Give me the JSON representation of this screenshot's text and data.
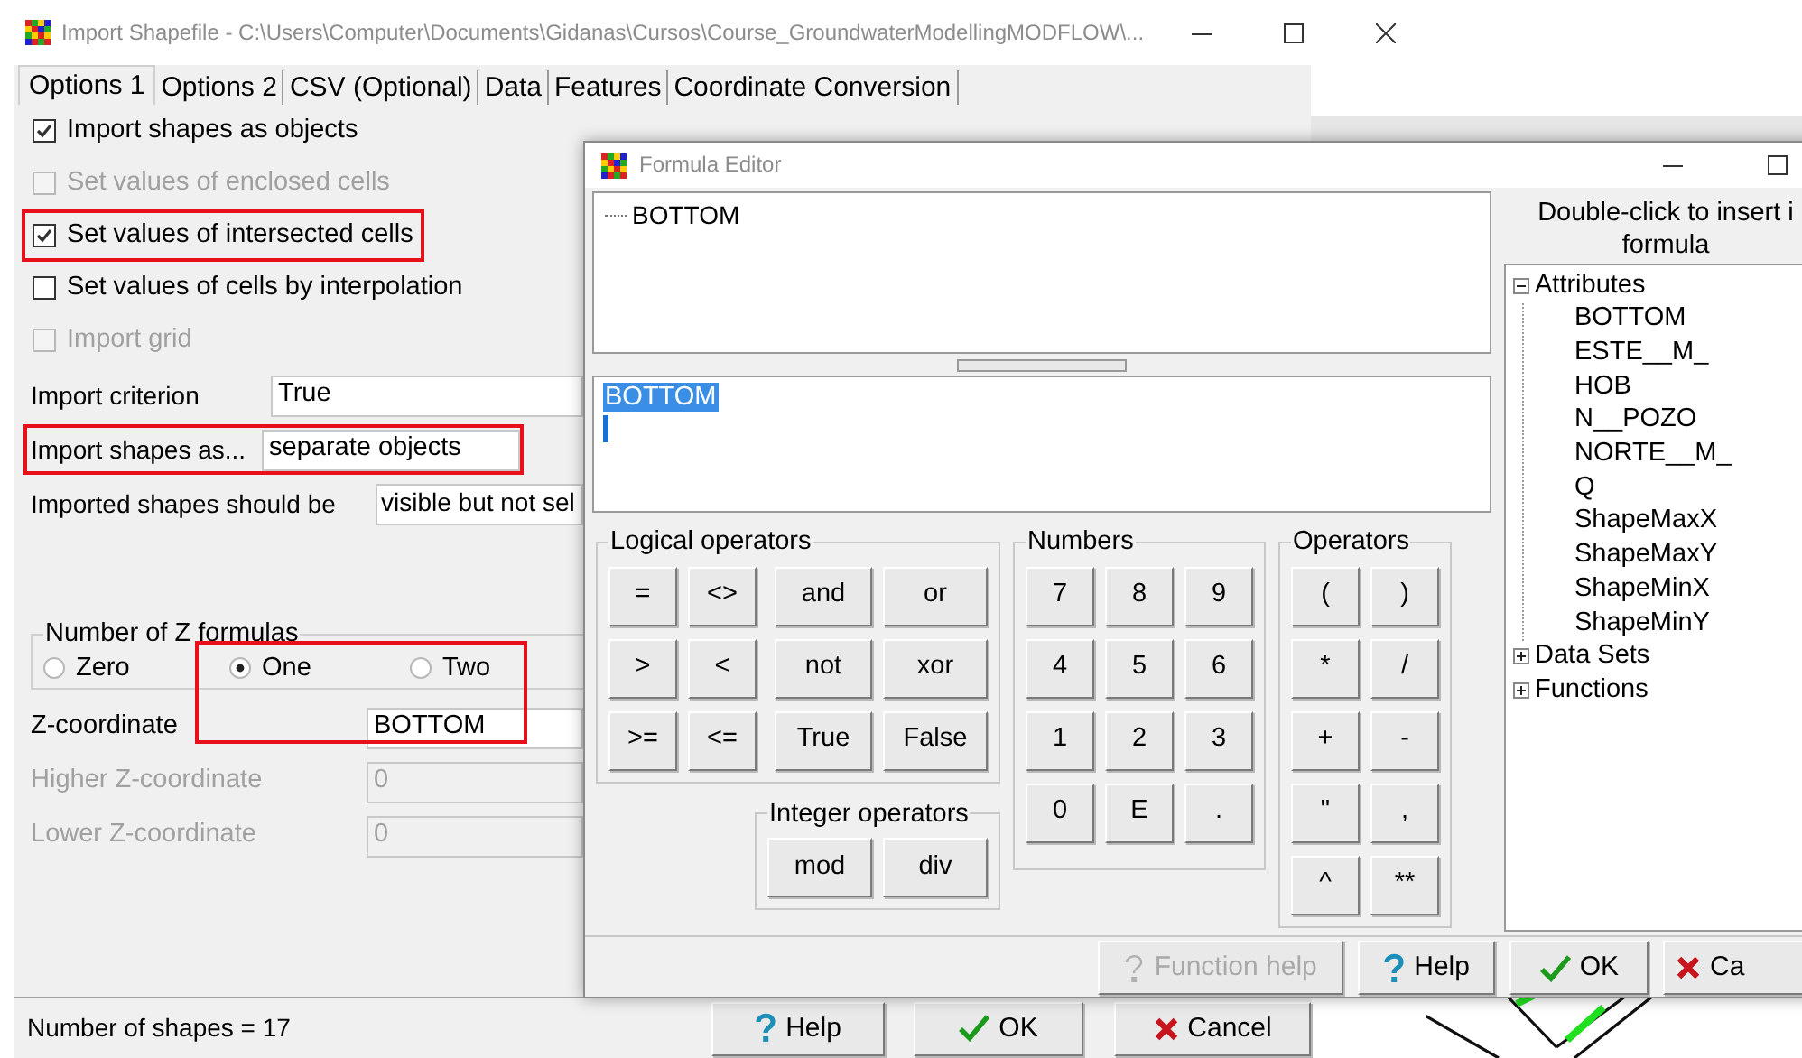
{
  "main_window": {
    "title": "Import Shapefile - C:\\Users\\Computer\\Documents\\Gidanas\\Cursos\\Course_GroundwaterModellingMODFLOW\\...",
    "tabs": [
      {
        "label": "Options 1",
        "selected": true
      },
      {
        "label": "Options 2",
        "selected": false
      },
      {
        "label": "CSV (Optional)",
        "selected": false
      },
      {
        "label": "Data",
        "selected": false
      },
      {
        "label": "Features",
        "selected": false
      },
      {
        "label": "Coordinate Conversion",
        "selected": false
      }
    ],
    "options": [
      {
        "label": "Import shapes as objects",
        "checked": true,
        "disabled": false,
        "highlighted": false
      },
      {
        "label": "Set values of enclosed cells",
        "checked": false,
        "disabled": true,
        "highlighted": false
      },
      {
        "label": "Set values of intersected cells",
        "checked": true,
        "disabled": false,
        "highlighted": true
      },
      {
        "label": "Set values of cells by interpolation",
        "checked": false,
        "disabled": false,
        "highlighted": false
      },
      {
        "label": "Import grid",
        "checked": false,
        "disabled": true,
        "highlighted": false
      }
    ],
    "fields": [
      {
        "label": "Import criterion",
        "value": "True",
        "highlighted": false
      },
      {
        "label": "Import shapes as...",
        "value": "separate objects",
        "highlighted": true
      },
      {
        "label": "Imported shapes should be",
        "value": "visible but not sel",
        "highlighted": false
      }
    ],
    "z_formulas": {
      "title": "Number of Z formulas",
      "highlighted": true,
      "options": [
        {
          "label": "Zero",
          "selected": false
        },
        {
          "label": "One",
          "selected": true
        },
        {
          "label": "Two",
          "selected": false
        }
      ]
    },
    "z_fields": [
      {
        "label": "Z-coordinate",
        "value": "BOTTOM",
        "disabled": false
      },
      {
        "label": "Higher Z-coordinate",
        "value": "0",
        "disabled": true
      },
      {
        "label": "Lower Z-coordinate",
        "value": "0",
        "disabled": true
      }
    ],
    "status": "Number of shapes = 17",
    "buttons": [
      {
        "label": "Help",
        "kind": "help"
      },
      {
        "label": "OK",
        "kind": "ok"
      },
      {
        "label": "Cancel",
        "kind": "cancel"
      }
    ]
  },
  "formula_editor": {
    "title": "Formula Editor",
    "expression_tree": [
      "BOTTOM"
    ],
    "formula": "BOTTOM",
    "groups": [
      {
        "title": "Logical operators",
        "buttons": [
          "=",
          "<>",
          "and",
          "or",
          ">",
          "<",
          "not",
          "xor",
          ">=",
          "<=",
          "True",
          "False"
        ]
      },
      {
        "title": "Integer operators",
        "buttons": [
          "mod",
          "div"
        ]
      },
      {
        "title": "Numbers",
        "buttons": [
          "7",
          "8",
          "9",
          "4",
          "5",
          "6",
          "1",
          "2",
          "3",
          "0",
          "E",
          "."
        ]
      },
      {
        "title": "Operators",
        "buttons": [
          "(",
          ")",
          "*",
          "/",
          "+",
          "-",
          "\"",
          ",",
          "^",
          "**"
        ]
      }
    ],
    "insert_panel": {
      "header_lines": [
        "Double-click to insert i",
        "formula"
      ],
      "tree": [
        {
          "label": "Attributes",
          "expanded": true,
          "children": [
            {
              "label": "BOTTOM"
            },
            {
              "label": "ESTE__M_"
            },
            {
              "label": "HOB"
            },
            {
              "label": "N__POZO"
            },
            {
              "label": "NORTE__M_"
            },
            {
              "label": "Q"
            },
            {
              "label": "ShapeMaxX"
            },
            {
              "label": "ShapeMaxY"
            },
            {
              "label": "ShapeMinX"
            },
            {
              "label": "ShapeMinY"
            }
          ]
        },
        {
          "label": "Data Sets",
          "expanded": false
        },
        {
          "label": "Functions",
          "expanded": false
        }
      ]
    },
    "buttons": [
      {
        "label": "Function help",
        "kind": "help",
        "disabled": true
      },
      {
        "label": "Help",
        "kind": "help",
        "disabled": false
      },
      {
        "label": "OK",
        "kind": "ok",
        "disabled": false
      },
      {
        "label": "Ca",
        "kind": "cancel",
        "disabled": false
      }
    ]
  }
}
